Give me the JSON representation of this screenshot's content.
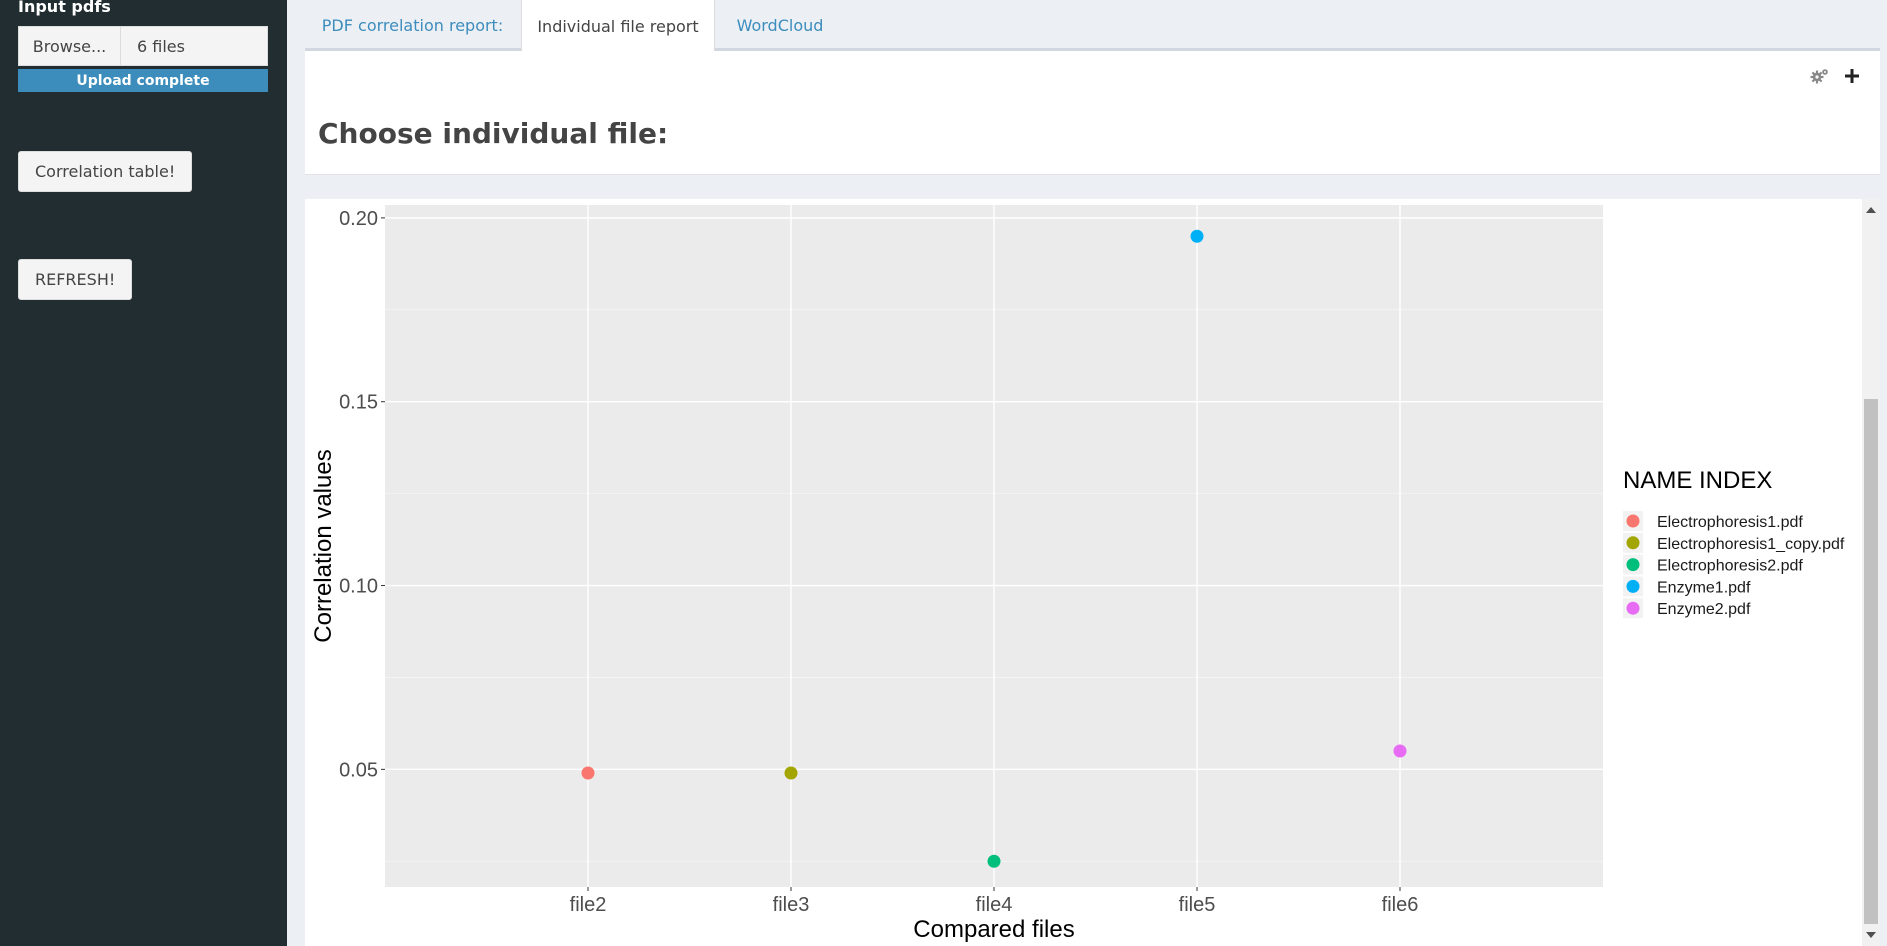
{
  "sidebar": {
    "input_label": "Input pdfs",
    "browse_label": "Browse...",
    "file_text": "6 files",
    "progress_text": "Upload complete",
    "progress_fraction": 1.0,
    "correlation_button": "Correlation table!",
    "refresh_button": "REFRESH!"
  },
  "tabs": [
    {
      "label": "PDF correlation report:",
      "active": false
    },
    {
      "label": "Individual file report",
      "active": true
    },
    {
      "label": "WordCloud",
      "active": false
    }
  ],
  "box": {
    "title": "Choose individual file:",
    "gear_icon": "gears-icon",
    "plus_icon": "plus-icon"
  },
  "chart_data": {
    "type": "scatter",
    "xlabel": "Compared files",
    "ylabel": "Correlation values",
    "categories": [
      "file2",
      "file3",
      "file4",
      "file5",
      "file6"
    ],
    "yticks": [
      0.05,
      0.1,
      0.15,
      0.2
    ],
    "ytick_labels": [
      "0.05",
      "0.10",
      "0.15",
      "0.20"
    ],
    "ylim": [
      0.018,
      0.2035
    ],
    "grid": true,
    "legend_title": "NAME INDEX",
    "legend_position": "right",
    "points": [
      {
        "x": "file2",
        "y": 0.049,
        "series": "Electrophoresis1.pdf",
        "color": "#F8766D"
      },
      {
        "x": "file3",
        "y": 0.049,
        "series": "Electrophoresis1_copy.pdf",
        "color": "#A3A500"
      },
      {
        "x": "file4",
        "y": 0.025,
        "series": "Electrophoresis2.pdf",
        "color": "#00BF7D"
      },
      {
        "x": "file5",
        "y": 0.195,
        "series": "Enzyme1.pdf",
        "color": "#00B0F6"
      },
      {
        "x": "file6",
        "y": 0.055,
        "series": "Enzyme2.pdf",
        "color": "#E76BF3"
      }
    ],
    "series": [
      {
        "name": "Electrophoresis1.pdf",
        "color": "#F8766D"
      },
      {
        "name": "Electrophoresis1_copy.pdf",
        "color": "#A3A500"
      },
      {
        "name": "Electrophoresis2.pdf",
        "color": "#00BF7D"
      },
      {
        "name": "Enzyme1.pdf",
        "color": "#00B0F6"
      },
      {
        "name": "Enzyme2.pdf",
        "color": "#E76BF3"
      }
    ]
  }
}
